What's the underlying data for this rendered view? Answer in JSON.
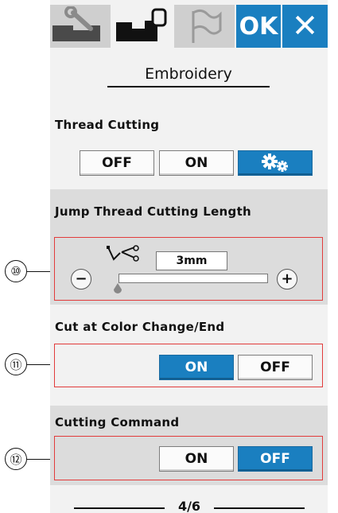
{
  "tabs": [
    {
      "name": "settings-tab",
      "icon": "wrench-icon"
    },
    {
      "name": "embroidery-tab",
      "icon": "embroidery-hoop-icon",
      "active": true
    },
    {
      "name": "language-tab",
      "icon": "flag-icon"
    }
  ],
  "ok_label": "OK",
  "close_symbol": "✕",
  "title": "Embroidery",
  "thread_cutting": {
    "label": "Thread Cutting",
    "off_label": "OFF",
    "on_label": "ON",
    "selected": "auto-settings"
  },
  "jump_thread": {
    "label": "Jump Thread Cutting Length",
    "value": "3mm",
    "minus": "−",
    "plus": "+",
    "callout": "⑩",
    "slider_level": 0.0
  },
  "cut_color_change": {
    "label": "Cut at Color Change/End",
    "on_label": "ON",
    "off_label": "OFF",
    "selected": "ON",
    "callout": "⑪"
  },
  "cutting_command": {
    "label": "Cutting Command",
    "on_label": "ON",
    "off_label": "OFF",
    "selected": "OFF",
    "callout": "⑫"
  },
  "page_indicator": "4/6",
  "colors": {
    "accent": "#1a7fc0",
    "callout_box": "#e23b3b",
    "panel": "#f2f2f2",
    "band": "#dcdcdc"
  }
}
